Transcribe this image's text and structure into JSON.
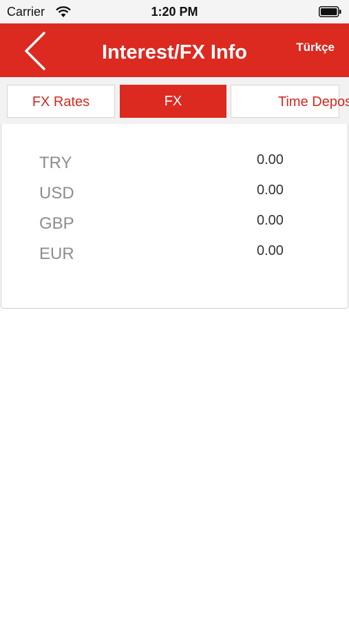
{
  "status_bar": {
    "carrier": "Carrier",
    "time": "1:20 PM"
  },
  "nav": {
    "title": "Interest/FX Info",
    "language": "Türkçe",
    "back_icon": "chevron-left-icon",
    "color": "#dc2a20"
  },
  "tabs": [
    {
      "label": "FX Rates",
      "active": false
    },
    {
      "label": "FX",
      "active": true
    },
    {
      "label": "Time Deposit",
      "active": false
    }
  ],
  "balances": [
    {
      "currency": "TRY",
      "amount": "0.00"
    },
    {
      "currency": "USD",
      "amount": "0.00"
    },
    {
      "currency": "GBP",
      "amount": "0.00"
    },
    {
      "currency": "EUR",
      "amount": "0.00"
    }
  ]
}
